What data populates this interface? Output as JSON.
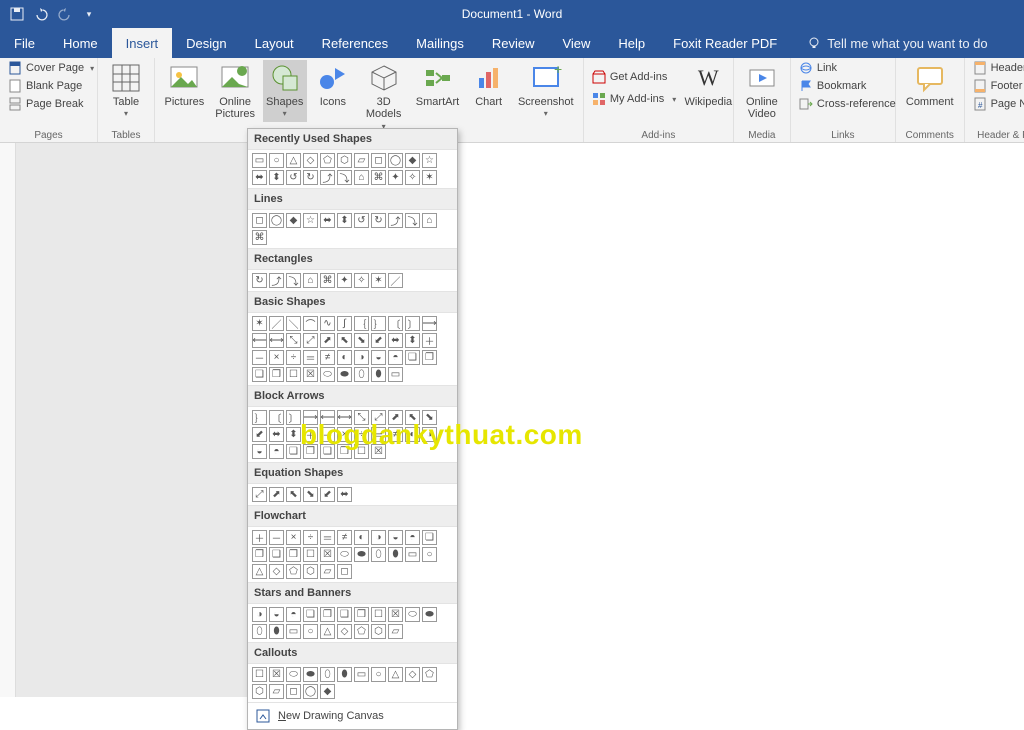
{
  "title": "Document1 - Word",
  "tabs": [
    "File",
    "Home",
    "Insert",
    "Design",
    "Layout",
    "References",
    "Mailings",
    "Review",
    "View",
    "Help",
    "Foxit Reader PDF"
  ],
  "active_tab": "Insert",
  "tellme": "Tell me what you want to do",
  "ribbon": {
    "pages": {
      "title": "Pages",
      "cover_page": "Cover Page",
      "blank_page": "Blank Page",
      "page_break": "Page Break"
    },
    "tables": {
      "title": "Tables",
      "table": "Table"
    },
    "illustrations": {
      "pictures": "Pictures",
      "online_pictures_l1": "Online",
      "online_pictures_l2": "Pictures",
      "shapes": "Shapes",
      "icons": "Icons",
      "models_l1": "3D",
      "models_l2": "Models",
      "smartart": "SmartArt",
      "chart": "Chart",
      "screenshot": "Screenshot"
    },
    "addins": {
      "title": "Add-ins",
      "get_addins": "Get Add-ins",
      "my_addins": "My Add-ins",
      "wikipedia": "Wikipedia"
    },
    "media": {
      "title": "Media",
      "online_video_l1": "Online",
      "online_video_l2": "Video"
    },
    "links": {
      "title": "Links",
      "link": "Link",
      "bookmark": "Bookmark",
      "cross_reference": "Cross-reference"
    },
    "comments": {
      "title": "Comments",
      "comment": "Comment"
    },
    "hf": {
      "title": "Header & Footer",
      "header": "Header",
      "footer": "Footer",
      "page_number": "Page Number"
    }
  },
  "shapes_panel": {
    "sections": [
      {
        "title": "Recently Used Shapes",
        "count": 22
      },
      {
        "title": "Lines",
        "count": 12
      },
      {
        "title": "Rectangles",
        "count": 9
      },
      {
        "title": "Basic Shapes",
        "count": 42
      },
      {
        "title": "Block Arrows",
        "count": 30
      },
      {
        "title": "Equation Shapes",
        "count": 6
      },
      {
        "title": "Flowchart",
        "count": 28
      },
      {
        "title": "Stars and Banners",
        "count": 20
      },
      {
        "title": "Callouts",
        "count": 16
      }
    ],
    "shape_glyphs": [
      "▭",
      "○",
      "△",
      "◇",
      "⬠",
      "⬡",
      "▱",
      "◻",
      "◯",
      "◆",
      "☆",
      "⬌",
      "⬍",
      "↺",
      "↻",
      "⤴",
      "⤵",
      "⌂",
      "⌘",
      "✦",
      "✧",
      "✶",
      "／",
      "＼",
      "⌒",
      "∿",
      "∫",
      "｛",
      "｝",
      "〔",
      "〕",
      "⟶",
      "⟵",
      "⟷",
      "⤡",
      "⤢",
      "⬈",
      "⬉",
      "⬊",
      "⬋",
      "⬌",
      "⬍",
      "＋",
      "－",
      "×",
      "÷",
      "＝",
      "≠",
      "◐",
      "◑",
      "◒",
      "◓",
      "❏",
      "❐",
      "❑",
      "❒",
      "☐",
      "☒",
      "⬭",
      "⬬",
      "⬯",
      "⬮"
    ],
    "footer_key": "N",
    "footer_text": "ew Drawing Canvas"
  },
  "watermark": "blogdankythuat.com",
  "colors": {
    "brand": "#2b579a",
    "ribbon_bg": "#f3f3f3"
  }
}
